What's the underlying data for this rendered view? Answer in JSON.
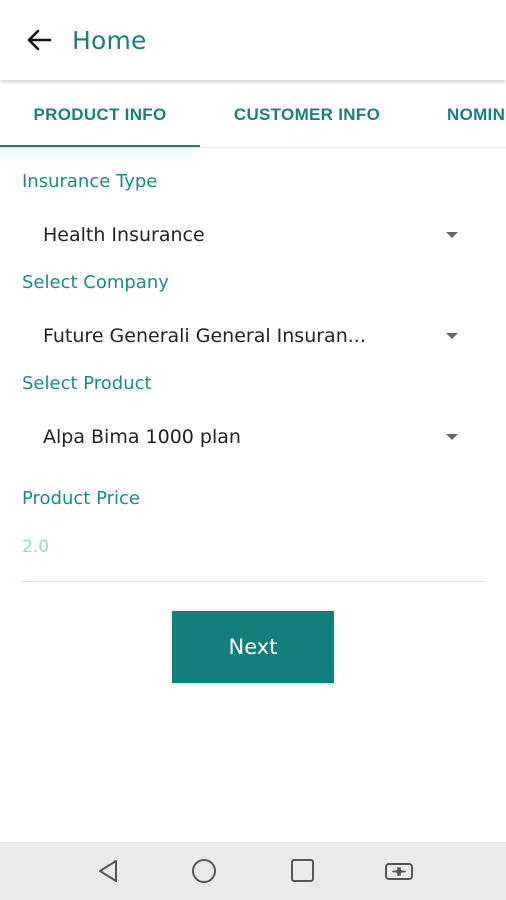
{
  "app_bar": {
    "title": "Home",
    "back_icon": "arrow-left-icon"
  },
  "tabs": [
    {
      "label": "PRODUCT INFO",
      "selected": true
    },
    {
      "label": "CUSTOMER INFO",
      "selected": false
    },
    {
      "label": "NOMIN",
      "selected": false
    }
  ],
  "form": {
    "insurance_type": {
      "label": "Insurance Type",
      "value": "Health Insurance"
    },
    "company": {
      "label": "Select Company",
      "value": "Future Generali General Insuran..."
    },
    "product": {
      "label": "Select Product",
      "value": "Alpa Bima 1000 plan"
    },
    "price": {
      "label": "Product Price",
      "value": "2.0"
    }
  },
  "next_button": {
    "label": "Next"
  },
  "colors": {
    "accent": "#137f7a",
    "label": "#1a8a85",
    "price_hint": "#9fd6d2"
  },
  "system_nav": [
    "back-triangle-icon",
    "home-circle-icon",
    "recents-square-icon",
    "switch-app-icon"
  ]
}
